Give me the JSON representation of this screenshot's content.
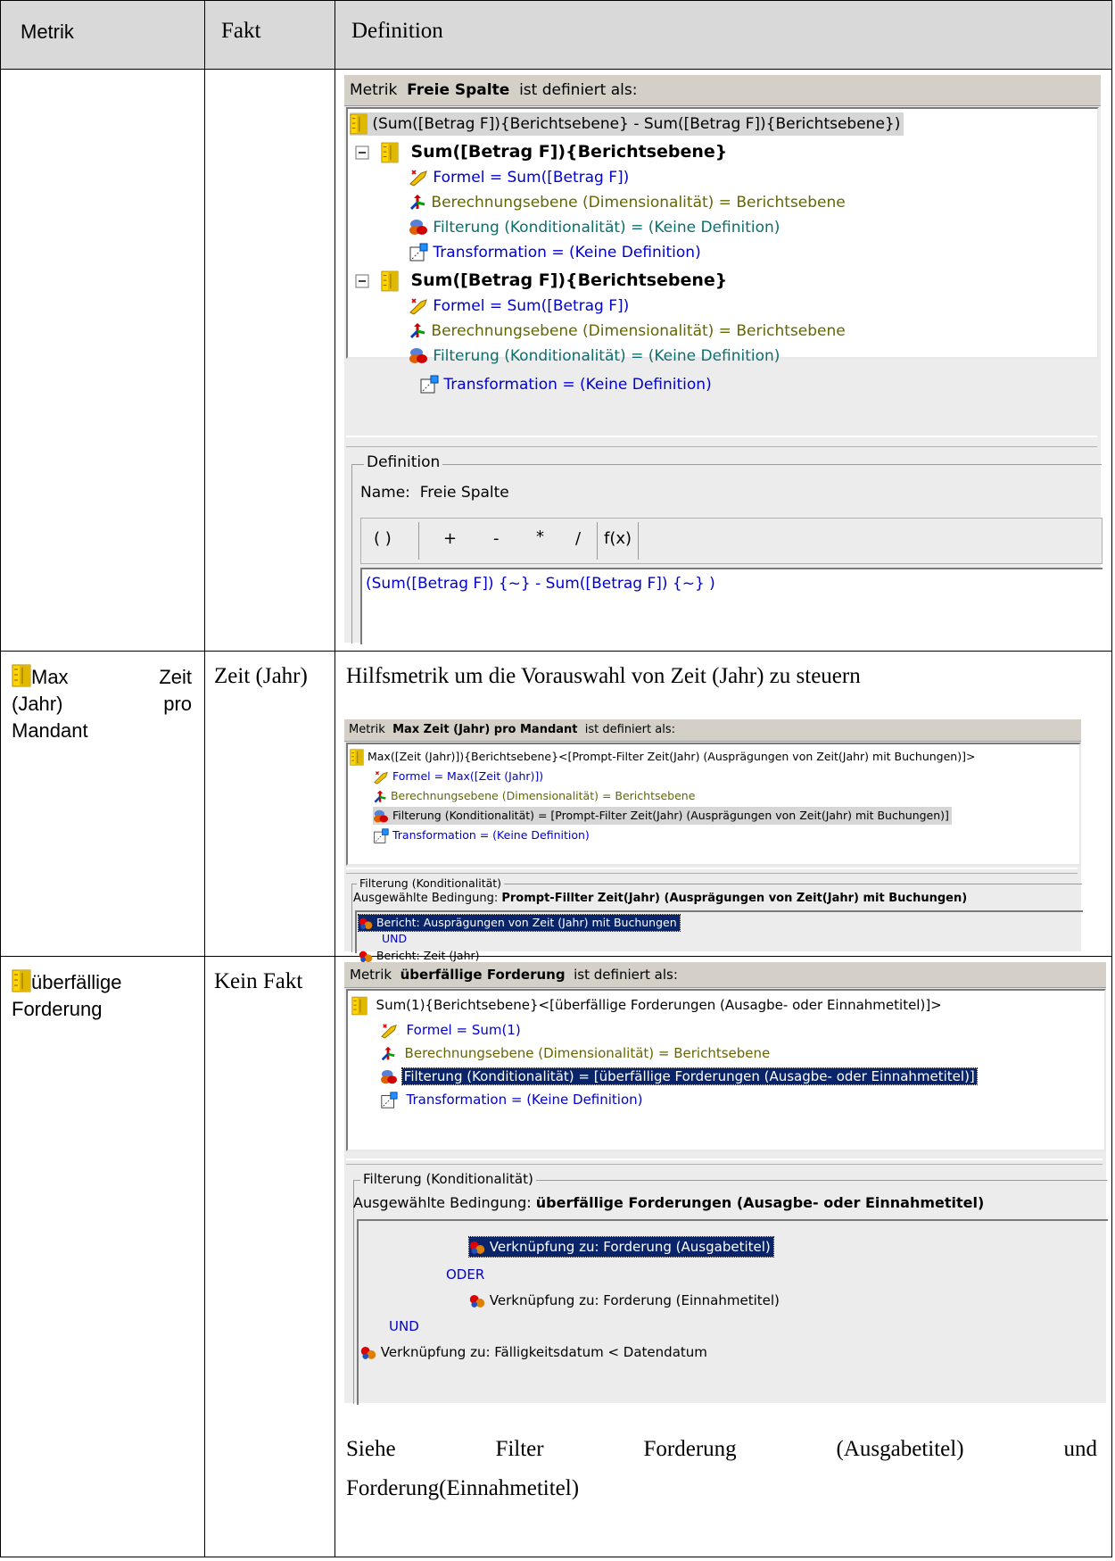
{
  "header": {
    "col_metric": "Metrik",
    "col_fact": "Fakt",
    "col_definition": "Definition"
  },
  "row1": {
    "panel": {
      "title_prefix": "Metrik",
      "title_name": "Freie Spalte",
      "title_suffix": "ist definiert als:",
      "root_formula": "(Sum([Betrag F]){Berichtsebene} - Sum([Betrag F]){Berichtsebene})",
      "node1_label": "Sum([Betrag F]){Berichtsebene}",
      "node2_label": "Sum([Betrag F]){Berichtsebene}",
      "formel": "Formel = Sum([Betrag F])",
      "berechnung": "Berechnungsebene (Dimensionalität) = Berichtsebene",
      "filterung": "Filterung (Konditionalität) = (Keine Definition)",
      "transformation": "Transformation = (Keine Definition)",
      "definition_group": "Definition",
      "name_label": "Name:",
      "name_value": "Freie Spalte",
      "tb_paren": "( )",
      "tb_plus": "+",
      "tb_minus": "-",
      "tb_mult": "*",
      "tb_div": "/",
      "tb_fx": "f(x)",
      "expression": "(Sum([Betrag F]) {~}  - Sum([Betrag F]) {~} )"
    }
  },
  "row2": {
    "metric_word1": "Max",
    "metric_word2": "Zeit",
    "metric_line2_a": "(Jahr)",
    "metric_line2_b": "pro",
    "metric_line3": "Mandant",
    "fact": "Zeit (Jahr)",
    "description": "Hilfsmetrik um die Vorauswahl von Zeit (Jahr) zu steuern",
    "panel": {
      "title_prefix": "Metrik",
      "title_name": "Max Zeit (Jahr) pro Mandant",
      "title_suffix": "ist definiert als:",
      "root_formula": "Max([Zeit (Jahr)]){Berichtsebene}<[Prompt-Filter Zeit(Jahr) (Ausprägungen von Zeit(Jahr) mit Buchungen)]>",
      "formel": "Formel = Max([Zeit (Jahr)])",
      "berechnung": "Berechnungsebene (Dimensionalität) = Berichtsebene",
      "filterung": "Filterung (Konditionalität) = [Prompt-Filter Zeit(Jahr) (Ausprägungen von Zeit(Jahr) mit Buchungen)]",
      "transformation": "Transformation = (Keine Definition)",
      "group_label": "Filterung (Konditionalität)",
      "cond_label": "Ausgewählte Bedingung:",
      "cond_value": "Prompt-Fillter Zeit(Jahr) (Ausprägungen von Zeit(Jahr) mit Buchungen)",
      "item1": "Bericht: Ausprägungen von Zeit (Jahr) mit Buchungen",
      "op": "UND",
      "item2": "Bericht: Zeit (Jahr)"
    }
  },
  "row3": {
    "metric_line1": "überfällige",
    "metric_line2": "Forderung",
    "fact": "Kein Fakt",
    "panel": {
      "title_prefix": "Metrik",
      "title_name": "überfällige Forderung",
      "title_suffix": "ist definiert als:",
      "root_formula": "Sum(1){Berichtsebene}<[überfällige Forderungen (Ausagbe- oder Einnahmetitel)]>",
      "formel": "Formel = Sum(1)",
      "berechnung": "Berechnungsebene (Dimensionalität) = Berichtsebene",
      "filterung": "Filterung (Konditionalität) = [überfällige Forderungen (Ausagbe- oder Einnahmetitel)]",
      "transformation": "Transformation = (Keine Definition)",
      "group_label": "Filterung (Konditionalität)",
      "cond_label": "Ausgewählte Bedingung:",
      "cond_value": "überfällige Forderungen (Ausagbe- oder Einnahmetitel)",
      "item1": "Verknüpfung zu: Forderung (Ausgabetitel)",
      "op1": "ODER",
      "item2": "Verknüpfung zu: Forderung (Einnahmetitel)",
      "op2": "UND",
      "item3": "Verknüpfung zu: Fälligkeitsdatum < Datendatum"
    },
    "note_words": [
      "Siehe",
      "Filter",
      "Forderung",
      "(Ausgabetitel)",
      "und"
    ],
    "note_line2": "Forderung(Einnahmetitel)"
  }
}
